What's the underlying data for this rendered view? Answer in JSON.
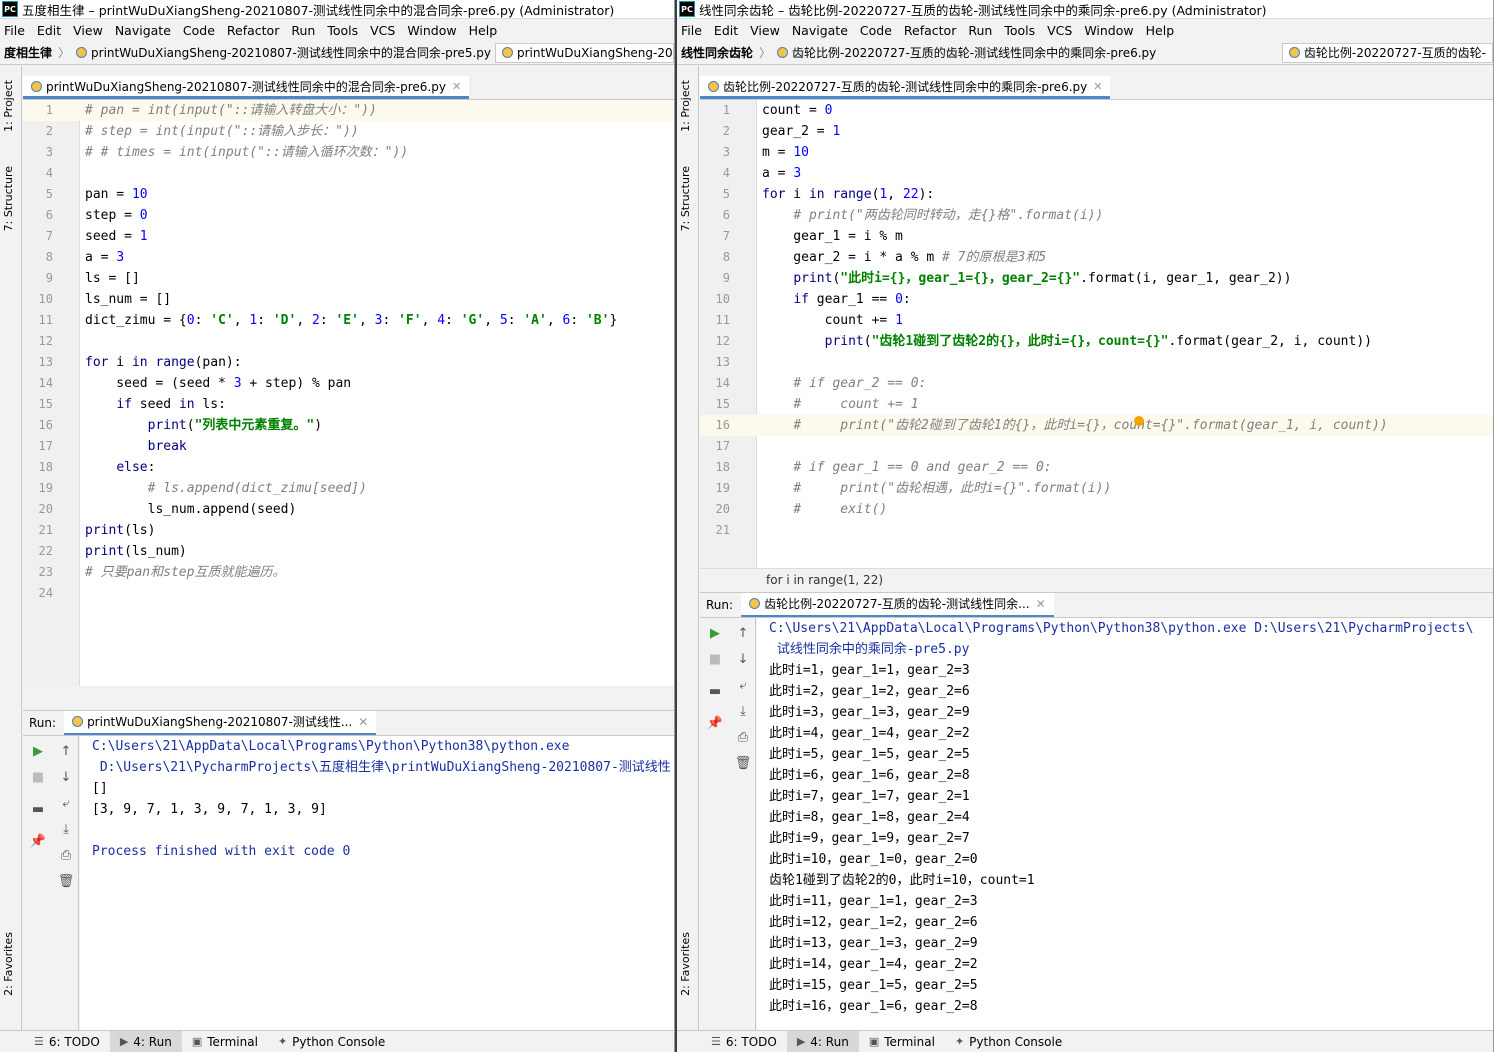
{
  "left": {
    "title": "五度相生律 – printWuDuXiangSheng-20210807-测试线性同余中的混合同余-pre6.py (Administrator)",
    "menu": [
      "File",
      "Edit",
      "View",
      "Navigate",
      "Code",
      "Refactor",
      "Run",
      "Tools",
      "VCS",
      "Window",
      "Help"
    ],
    "crumb_project": "度相生律",
    "crumb_file": "printWuDuXiangSheng-20210807-测试线性同余中的混合同余-pre5.py",
    "nav_tab": "printWuDuXiangSheng-20",
    "editor_tab": "printWuDuXiangSheng-20210807-测试线性同余中的混合同余-pre6.py",
    "side_project": "1: Project",
    "side_structure": "7: Structure",
    "side_favorites": "2: Favorites",
    "run_label": "Run:",
    "run_tab": "printWuDuXiangSheng-20210807-测试线性...",
    "console": [
      {
        "t": "C:\\Users\\21\\AppData\\Local\\Programs\\Python\\Python38\\python.exe",
        "cls": "blue"
      },
      {
        "t": " D:\\Users\\21\\PycharmProjects\\五度相生律\\printWuDuXiangSheng-20210807-测试线性",
        "cls": "blue"
      },
      {
        "t": "[]",
        "cls": ""
      },
      {
        "t": "[3, 9, 7, 1, 3, 9, 7, 1, 3, 9]",
        "cls": ""
      },
      {
        "t": "",
        "cls": ""
      },
      {
        "t": "Process finished with exit code 0",
        "cls": "blue"
      }
    ],
    "status": [
      "6: TODO",
      "4: Run",
      "Terminal",
      "Python Console"
    ]
  },
  "right": {
    "title": "线性同余齿轮 – 齿轮比例-20220727-互质的齿轮-测试线性同余中的乘同余-pre6.py (Administrator)",
    "menu": [
      "File",
      "Edit",
      "View",
      "Navigate",
      "Code",
      "Refactor",
      "Run",
      "Tools",
      "VCS",
      "Window",
      "Help"
    ],
    "crumb_project": "线性同余齿轮",
    "crumb_file": "齿轮比例-20220727-互质的齿轮-测试线性同余中的乘同余-pre6.py",
    "nav_tab": "齿轮比例-20220727-互质的齿轮-",
    "editor_tab": "齿轮比例-20220727-互质的齿轮-测试线性同余中的乘同余-pre6.py",
    "side_project": "1: Project",
    "side_structure": "7: Structure",
    "side_favorites": "2: Favorites",
    "breadcrumb": "for i in range(1, 22)",
    "run_label": "Run:",
    "run_tab": "齿轮比例-20220727-互质的齿轮-测试线性同余...",
    "console": [
      {
        "t": "C:\\Users\\21\\AppData\\Local\\Programs\\Python\\Python38\\python.exe D:\\Users\\21\\PycharmProjects\\",
        "cls": "blue"
      },
      {
        "t": " 试线性同余中的乘同余-pre5.py",
        "cls": "blue"
      },
      {
        "t": "此时i=1，gear_1=1，gear_2=3",
        "cls": ""
      },
      {
        "t": "此时i=2，gear_1=2，gear_2=6",
        "cls": ""
      },
      {
        "t": "此时i=3，gear_1=3，gear_2=9",
        "cls": ""
      },
      {
        "t": "此时i=4，gear_1=4，gear_2=2",
        "cls": ""
      },
      {
        "t": "此时i=5，gear_1=5，gear_2=5",
        "cls": ""
      },
      {
        "t": "此时i=6，gear_1=6，gear_2=8",
        "cls": ""
      },
      {
        "t": "此时i=7，gear_1=7，gear_2=1",
        "cls": ""
      },
      {
        "t": "此时i=8，gear_1=8，gear_2=4",
        "cls": ""
      },
      {
        "t": "此时i=9，gear_1=9，gear_2=7",
        "cls": ""
      },
      {
        "t": "此时i=10，gear_1=0，gear_2=0",
        "cls": ""
      },
      {
        "t": "齿轮1碰到了齿轮2的0，此时i=10，count=1",
        "cls": ""
      },
      {
        "t": "此时i=11，gear_1=1，gear_2=3",
        "cls": ""
      },
      {
        "t": "此时i=12，gear_1=2，gear_2=6",
        "cls": ""
      },
      {
        "t": "此时i=13，gear_1=3，gear_2=9",
        "cls": ""
      },
      {
        "t": "此时i=14，gear_1=4，gear_2=2",
        "cls": ""
      },
      {
        "t": "此时i=15，gear_1=5，gear_2=5",
        "cls": ""
      },
      {
        "t": "此时i=16，gear_1=6，gear_2=8",
        "cls": ""
      }
    ],
    "status": [
      "6: TODO",
      "4: Run",
      "Terminal",
      "Python Console"
    ]
  },
  "code_left": [
    [
      [
        "c",
        "# pan = int(input(\"::请输入转盘大小：\"))"
      ]
    ],
    [
      [
        "c",
        "# step = int(input(\"::请输入步长：\"))"
      ]
    ],
    [
      [
        "c",
        "# # times = int(input(\"::请输入循环次数：\"))"
      ]
    ],
    [],
    [
      [
        "",
        "pan = "
      ],
      [
        "n",
        "10"
      ]
    ],
    [
      [
        "",
        "step = "
      ],
      [
        "n",
        "0"
      ]
    ],
    [
      [
        "",
        "seed = "
      ],
      [
        "n",
        "1"
      ]
    ],
    [
      [
        "",
        "a = "
      ],
      [
        "n",
        "3"
      ]
    ],
    [
      [
        "",
        "ls = []"
      ]
    ],
    [
      [
        "",
        "ls_num = []"
      ]
    ],
    [
      [
        "",
        "dict_zimu = {"
      ],
      [
        "n",
        "0"
      ],
      [
        "",
        ": "
      ],
      [
        "s",
        "'C'"
      ],
      [
        "",
        ", "
      ],
      [
        "n",
        "1"
      ],
      [
        "",
        ": "
      ],
      [
        "s",
        "'D'"
      ],
      [
        "",
        ", "
      ],
      [
        "n",
        "2"
      ],
      [
        "",
        ": "
      ],
      [
        "s",
        "'E'"
      ],
      [
        "",
        ", "
      ],
      [
        "n",
        "3"
      ],
      [
        "",
        ": "
      ],
      [
        "s",
        "'F'"
      ],
      [
        "",
        ", "
      ],
      [
        "n",
        "4"
      ],
      [
        "",
        ": "
      ],
      [
        "s",
        "'G'"
      ],
      [
        "",
        ", "
      ],
      [
        "n",
        "5"
      ],
      [
        "",
        ": "
      ],
      [
        "s",
        "'A'"
      ],
      [
        "",
        ", "
      ],
      [
        "n",
        "6"
      ],
      [
        "",
        ": "
      ],
      [
        "s",
        "'B'"
      ],
      [
        "",
        "}"
      ]
    ],
    [],
    [
      [
        "kw",
        "for"
      ],
      [
        "",
        " i "
      ],
      [
        "kw",
        "in"
      ],
      [
        "",
        "",
        " "
      ],
      [
        "kw",
        "range"
      ],
      [
        "",
        "(pan):"
      ]
    ],
    [
      [
        "",
        "    seed = (seed * "
      ],
      [
        "n",
        "3"
      ],
      [
        "",
        " + step) % pan"
      ]
    ],
    [
      [
        "",
        "    "
      ],
      [
        "kw",
        "if"
      ],
      [
        "",
        " seed "
      ],
      [
        "kw",
        "in"
      ],
      [
        "",
        " ls:"
      ]
    ],
    [
      [
        "",
        "        "
      ],
      [
        "kw",
        "print"
      ],
      [
        "",
        "("
      ],
      [
        "s",
        "\"列表中元素重复。\""
      ],
      [
        "",
        ")"
      ]
    ],
    [
      [
        "",
        "        "
      ],
      [
        "kw",
        "break"
      ]
    ],
    [
      [
        "",
        "    "
      ],
      [
        "kw",
        "else"
      ],
      [
        "",
        ":"
      ]
    ],
    [
      [
        "",
        "        "
      ],
      [
        "c",
        "# ls.append(dict_zimu[seed])"
      ]
    ],
    [
      [
        "",
        "        ls_num.append(seed)"
      ]
    ],
    [
      [
        "kw",
        "print"
      ],
      [
        "",
        "(ls)"
      ]
    ],
    [
      [
        "kw",
        "print"
      ],
      [
        "",
        "(ls_num)"
      ]
    ],
    [
      [
        "c",
        "# 只要pan和step互质就能遍历。"
      ]
    ],
    []
  ],
  "code_right": [
    [
      [
        "",
        "count = "
      ],
      [
        "n",
        "0"
      ]
    ],
    [
      [
        "",
        "gear_2 = "
      ],
      [
        "n",
        "1"
      ]
    ],
    [
      [
        "",
        "m = "
      ],
      [
        "n",
        "10"
      ]
    ],
    [
      [
        "",
        "a = "
      ],
      [
        "n",
        "3"
      ]
    ],
    [
      [
        "kw",
        "for"
      ],
      [
        "",
        " i "
      ],
      [
        "kw",
        "in"
      ],
      [
        "",
        "",
        " "
      ],
      [
        "kw",
        "range"
      ],
      [
        "",
        "("
      ],
      [
        "n",
        "1"
      ],
      [
        "",
        ", "
      ],
      [
        "n",
        "22"
      ],
      [
        "",
        "):"
      ]
    ],
    [
      [
        "",
        "    "
      ],
      [
        "c",
        "# print(\"两齿轮同时转动，走{}格\".format(i))"
      ]
    ],
    [
      [
        "",
        "    gear_1 = i % m"
      ]
    ],
    [
      [
        "",
        "    gear_2 = i * a % m "
      ],
      [
        "c",
        "# 7的原根是3和5"
      ]
    ],
    [
      [
        "",
        "    "
      ],
      [
        "kw",
        "print"
      ],
      [
        "",
        "("
      ],
      [
        "s",
        "\"此时i={}，gear_1={}，gear_2={}\""
      ],
      [
        "",
        ".format(i, gear_1, gear_2))"
      ]
    ],
    [
      [
        "",
        "    "
      ],
      [
        "kw",
        "if"
      ],
      [
        "",
        " gear_1 == "
      ],
      [
        "n",
        "0"
      ],
      [
        "",
        ":"
      ]
    ],
    [
      [
        "",
        "        count += "
      ],
      [
        "n",
        "1"
      ]
    ],
    [
      [
        "",
        "        "
      ],
      [
        "kw",
        "print"
      ],
      [
        "",
        "("
      ],
      [
        "s",
        "\"齿轮1碰到了齿轮2的{}，此时i={}，count={}\""
      ],
      [
        "",
        ".format(gear_2, i, count))"
      ]
    ],
    [],
    [
      [
        "",
        "    "
      ],
      [
        "c",
        "# if gear_2 == 0:"
      ]
    ],
    [
      [
        "",
        "    "
      ],
      [
        "c",
        "#     count += 1"
      ]
    ],
    [
      [
        "",
        "    "
      ],
      [
        "c",
        "#     print(\"齿轮2碰到了齿轮1的{}，此时i={}，count={}\".format(gear_1, i, count))"
      ]
    ],
    [],
    [
      [
        "",
        "    "
      ],
      [
        "c",
        "# if gear_1 == 0 and gear_2 == 0:"
      ]
    ],
    [
      [
        "",
        "    "
      ],
      [
        "c",
        "#     print(\"齿轮相遇，此时i={}\".format(i))"
      ]
    ],
    [
      [
        "",
        "    "
      ],
      [
        "c",
        "#     exit()"
      ]
    ],
    []
  ]
}
